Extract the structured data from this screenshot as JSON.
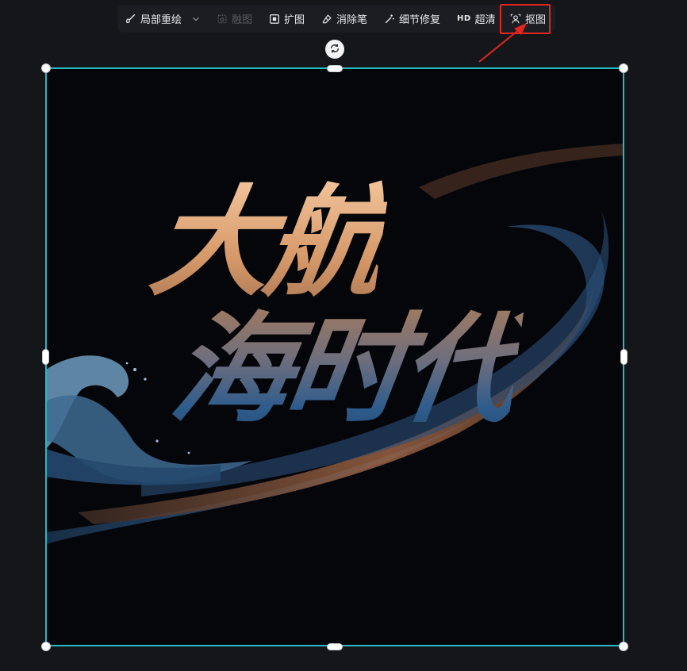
{
  "toolbar": {
    "items": [
      {
        "label": "局部重绘",
        "icon": "brush-icon",
        "has_dropdown": true,
        "enabled": true
      },
      {
        "label": "融图",
        "icon": "merge-image-icon",
        "enabled": false
      },
      {
        "label": "扩图",
        "icon": "expand-image-icon",
        "enabled": true
      },
      {
        "label": "消除笔",
        "icon": "eraser-icon",
        "enabled": true
      },
      {
        "label": "细节修复",
        "icon": "magic-wand-icon",
        "enabled": true
      },
      {
        "label": "超清",
        "icon": "hd-icon",
        "icon_text": "HD",
        "enabled": true
      },
      {
        "label": "抠图",
        "icon": "cutout-icon",
        "enabled": true,
        "highlighted": true
      }
    ]
  },
  "canvas": {
    "artwork_text": [
      "大航",
      "海时代"
    ],
    "rotate_icon": "rotate-icon"
  },
  "colors": {
    "background": "#15161a",
    "toolbar": "#1c1d22",
    "selection": "#27b8c2",
    "highlight": "#e0261f",
    "title_top": "#f2c49b",
    "title_bottom": "#2e5c8c"
  }
}
